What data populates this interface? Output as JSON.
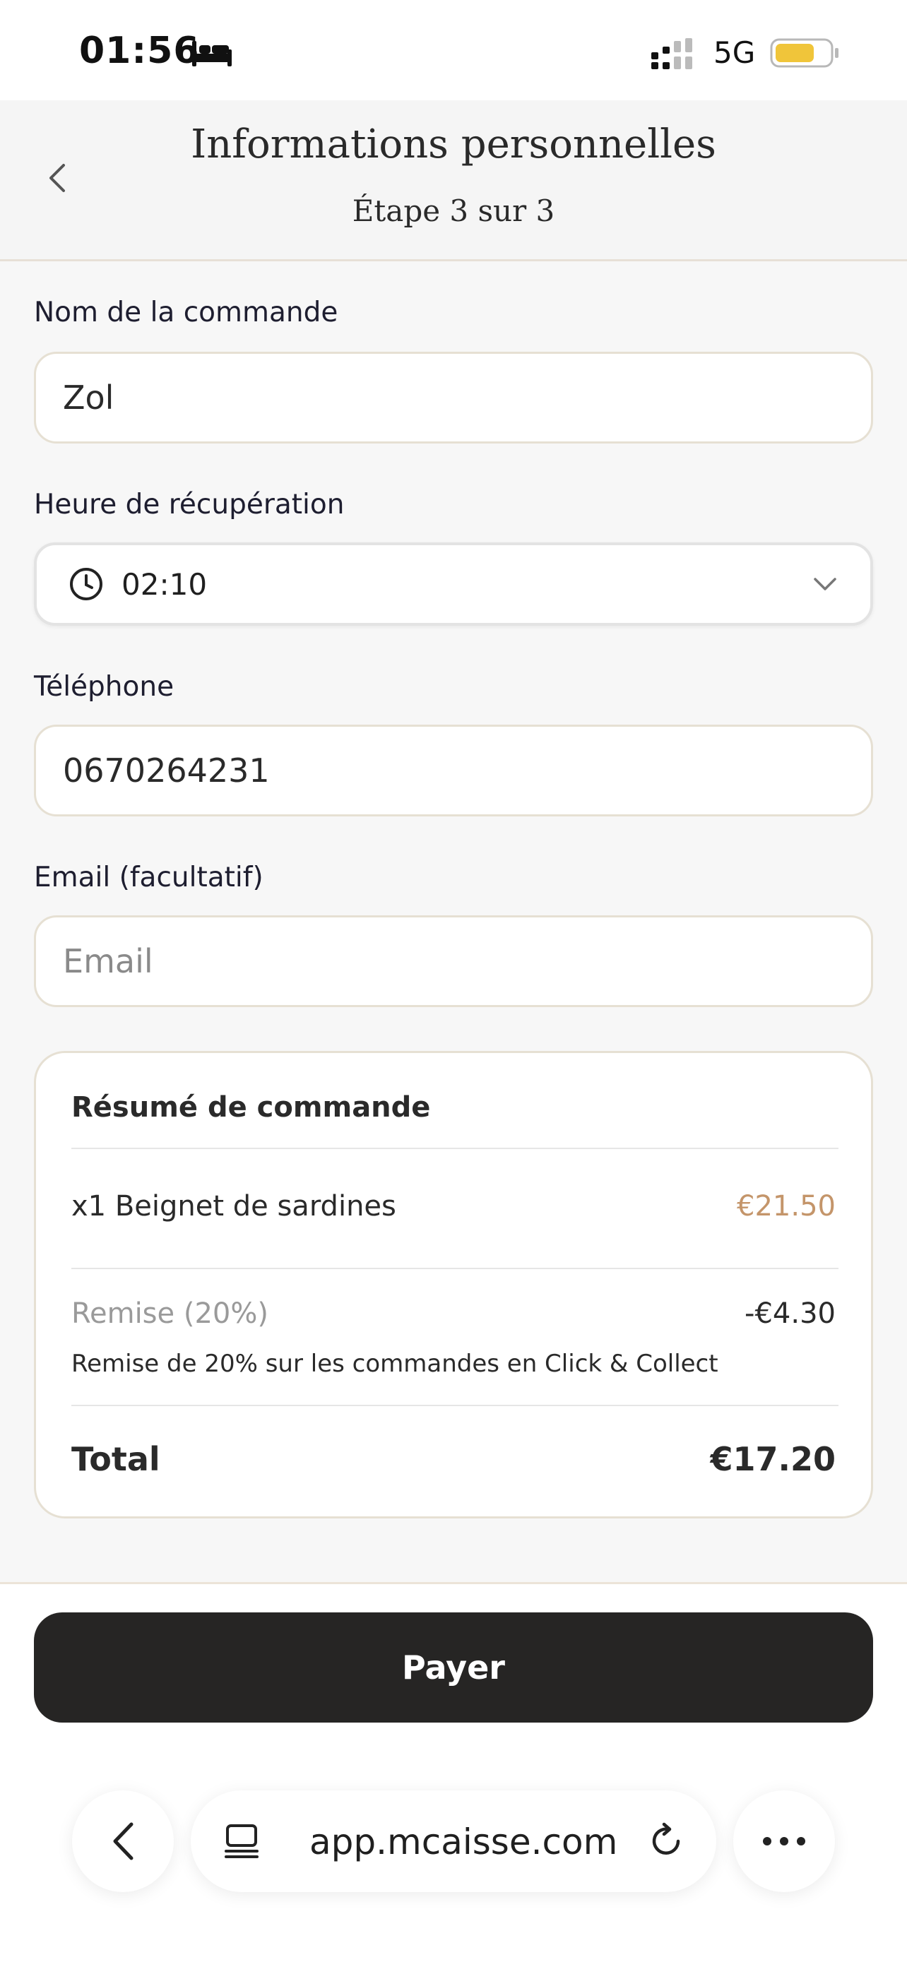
{
  "status_bar": {
    "time": "01:56",
    "network": "5G",
    "icons": [
      "bed-icon",
      "signal-icon",
      "battery-icon"
    ],
    "battery_color": "#f0c53a"
  },
  "header": {
    "title": "Informations personnelles",
    "subtitle": "Étape 3 sur 3"
  },
  "form": {
    "order_name": {
      "label": "Nom de la commande",
      "value": "Zol"
    },
    "pickup_time": {
      "label": "Heure de récupération",
      "value": "02:10"
    },
    "phone": {
      "label": "Téléphone",
      "value": "0670264231"
    },
    "email": {
      "label": "Email (facultatif)",
      "value": "",
      "placeholder": "Email"
    }
  },
  "summary": {
    "title": "Résumé de commande",
    "item": {
      "name": "x1 Beignet de sardines",
      "price": "€21.50"
    },
    "discount": {
      "label": "Remise (20%)",
      "amount": "-€4.30",
      "description": "Remise de 20% sur les commandes en Click & Collect"
    },
    "total": {
      "label": "Total",
      "amount": "€17.20"
    }
  },
  "actions": {
    "pay_label": "Payer"
  },
  "browser": {
    "url": "app.mcaisse.com"
  },
  "colors": {
    "price_accent": "#c4956a",
    "pay_button": "#262524",
    "border_beige": "#e6e0d3"
  }
}
